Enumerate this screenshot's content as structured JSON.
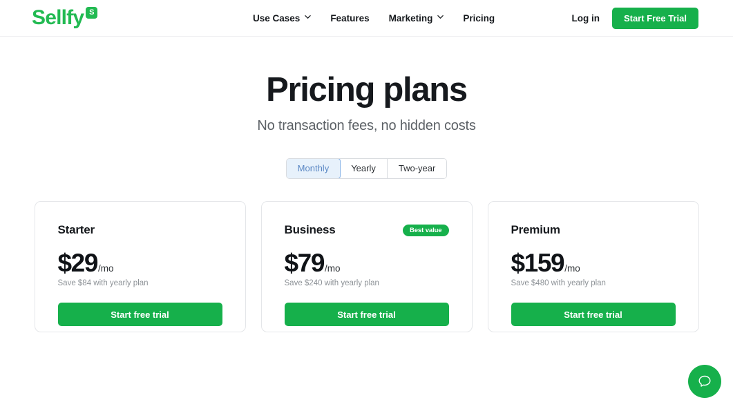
{
  "header": {
    "logo_text": "Sellfy",
    "logo_badge": "S",
    "nav": [
      {
        "label": "Use Cases",
        "has_dropdown": true
      },
      {
        "label": "Features",
        "has_dropdown": false
      },
      {
        "label": "Marketing",
        "has_dropdown": true
      },
      {
        "label": "Pricing",
        "has_dropdown": false
      }
    ],
    "login_label": "Log in",
    "trial_label": "Start Free Trial"
  },
  "hero": {
    "title": "Pricing plans",
    "subtitle": "No transaction fees, no hidden costs"
  },
  "billing_toggle": {
    "options": [
      {
        "label": "Monthly",
        "selected": true
      },
      {
        "label": "Yearly",
        "selected": false
      },
      {
        "label": "Two-year",
        "selected": false
      }
    ]
  },
  "plans": [
    {
      "name": "Starter",
      "badge": "",
      "price": "$29",
      "period": "/mo",
      "save_note": "Save $84 with yearly plan",
      "cta_label": "Start free trial"
    },
    {
      "name": "Business",
      "badge": "Best value",
      "price": "$79",
      "period": "/mo",
      "save_note": "Save $240 with yearly plan",
      "cta_label": "Start free trial"
    },
    {
      "name": "Premium",
      "badge": "",
      "price": "$159",
      "period": "/mo",
      "save_note": "Save $480 with yearly plan",
      "cta_label": "Start free trial"
    }
  ],
  "chat_widget": {
    "icon": "chat-bubble-icon"
  },
  "colors": {
    "brand_green": "#16b04b",
    "logo_green": "#22ba52",
    "toggle_active_bg": "#e7f1fb",
    "toggle_active_text": "#5a87c4",
    "toggle_active_border": "#8ab4e8",
    "text_primary": "#16191d",
    "text_muted": "#8c9196",
    "subtitle_gray": "#5c6166",
    "card_border": "#e4e6e9"
  }
}
